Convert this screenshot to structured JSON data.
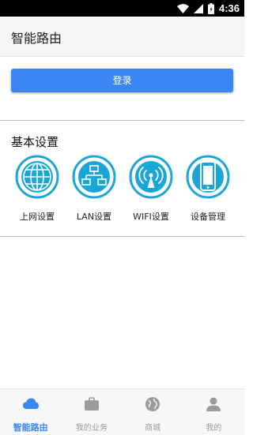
{
  "status_bar": {
    "time": "4:36",
    "icons": [
      "wifi-icon",
      "signal-icon",
      "battery-icon"
    ]
  },
  "app_bar": {
    "title": "智能路由"
  },
  "login": {
    "button_label": "登录"
  },
  "basic_settings": {
    "title": "基本设置",
    "items": [
      {
        "label": "上网设置",
        "icon": "globe-icon"
      },
      {
        "label": "LAN设置",
        "icon": "network-topology-icon"
      },
      {
        "label": "WIFI设置",
        "icon": "wifi-antenna-icon"
      },
      {
        "label": "设备管理",
        "icon": "phone-icon"
      }
    ]
  },
  "bottom_nav": {
    "items": [
      {
        "label": "智能路由",
        "icon": "cloud-icon",
        "active": true
      },
      {
        "label": "我的业务",
        "icon": "briefcase-icon",
        "active": false
      },
      {
        "label": "商城",
        "icon": "globe-icon",
        "active": false
      },
      {
        "label": "我的",
        "icon": "user-icon",
        "active": false
      }
    ]
  },
  "colors": {
    "accent": "#3b86f2",
    "icon_cyan": "#1aa6d6",
    "status_bar": "#000000",
    "inactive_nav": "#9b9b9b"
  }
}
